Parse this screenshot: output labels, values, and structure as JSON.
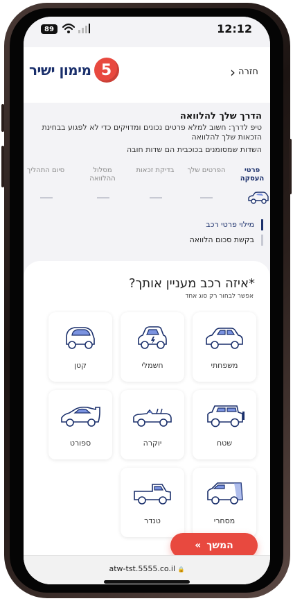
{
  "status_bar": {
    "battery": "89",
    "time": "12:12"
  },
  "header": {
    "back_label": "חזרה",
    "logo_number": "5",
    "logo_text": "מימון ישיר"
  },
  "guide": {
    "title": "הדרך שלך להלוואה",
    "tip": "טיפ לדרך: חשוב למלא פרטים נכונים ומדויקים כדי לא לפגוע בבחינת הזכאות שלך להלוואה",
    "note": "השדות שמסומנים בכוכבית הם שדות חובה"
  },
  "stepper": {
    "steps": [
      {
        "label": "פרטי העסקה",
        "active": true
      },
      {
        "label": "הפרטים שלך",
        "active": false
      },
      {
        "label": "בדיקת זכאות",
        "active": false
      },
      {
        "label": "מסלול ההלוואה",
        "active": false
      },
      {
        "label": "סיום התהליך",
        "active": false
      }
    ],
    "sub_steps": [
      {
        "label": "מילוי פרטי רכב",
        "active": true
      },
      {
        "label": "בקשת סכום הלוואה",
        "active": false
      }
    ]
  },
  "question": {
    "title": "*איזה רכב מעניין אותך?",
    "subtitle": "אפשר לבחור רק סוג אחד"
  },
  "vehicle_types": [
    {
      "label": "משפחתי",
      "icon": "family-car-icon"
    },
    {
      "label": "חשמלי",
      "icon": "electric-car-icon"
    },
    {
      "label": "קטן",
      "icon": "small-car-icon"
    },
    {
      "label": "שטח",
      "icon": "suv-icon"
    },
    {
      "label": "יוקרה",
      "icon": "convertible-icon"
    },
    {
      "label": "ספורט",
      "icon": "sports-car-icon"
    },
    {
      "label": "מסחרי",
      "icon": "van-icon"
    },
    {
      "label": "טנדר",
      "icon": "pickup-icon"
    }
  ],
  "continue_button": {
    "label": "המשך",
    "arrow": "»"
  },
  "url_bar": {
    "url": "atw-tst.5555.co.il",
    "lock": "🔒"
  },
  "colors": {
    "brand_navy": "#1a2f6b",
    "brand_red": "#e8493f",
    "icon_accent": "#7b93e0"
  }
}
